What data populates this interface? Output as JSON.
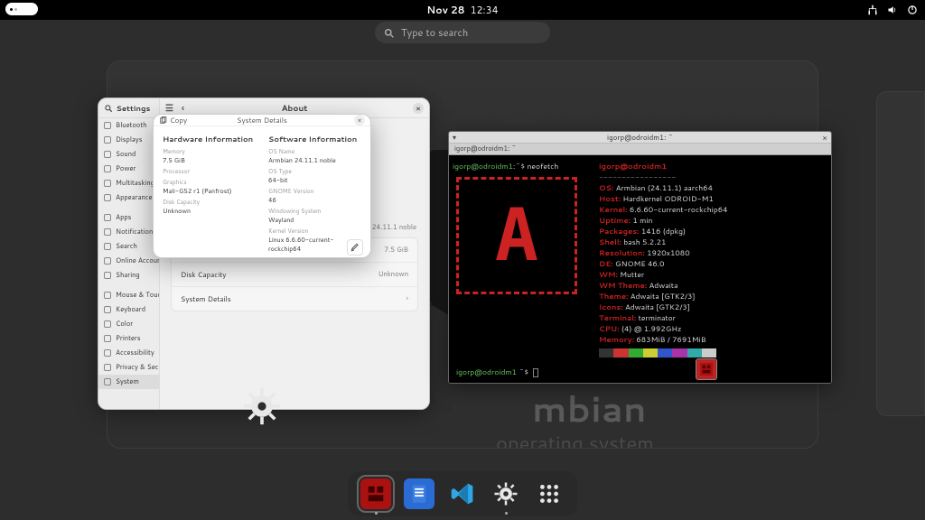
{
  "topbar": {
    "date": "Nov 28",
    "time": "12:34"
  },
  "search": {
    "placeholder": "Type to search"
  },
  "settings": {
    "sidebar_title": "Settings",
    "main_title": "About",
    "items": [
      "Bluetooth",
      "Displays",
      "Sound",
      "Power",
      "Multitasking",
      "Appearance",
      "Apps",
      "Notifications",
      "Search",
      "Online Accounts",
      "Sharing",
      "Mouse & Touchpad",
      "Keyboard",
      "Color",
      "Printers",
      "Accessibility",
      "Privacy & Security",
      "System"
    ],
    "about_rows": [
      {
        "k": "Memory",
        "v": "7.5 GiB"
      },
      {
        "k": "Disk Capacity",
        "v": "Unknown"
      },
      {
        "k": "System Details",
        "v": ""
      }
    ],
    "about_topline": "Armbian 24.11.1 noble"
  },
  "details": {
    "title": "System Details",
    "copy": "Copy",
    "hw": {
      "title": "Hardware Information",
      "memory_k": "Memory",
      "memory": "7.5 GiB",
      "proc_k": "Processor",
      "proc": "",
      "gpu_k": "Graphics",
      "gpu": "Mali-G52 r1 (Panfrost)",
      "disk_k": "Disk Capacity",
      "disk": "Unknown"
    },
    "sw": {
      "title": "Software Information",
      "os_k": "OS Name",
      "os": "Armbian 24.11.1 noble",
      "type_k": "OS Type",
      "type": "64-bit",
      "gnome_k": "GNOME Version",
      "gnome": "46",
      "ws_k": "Windowing System",
      "ws": "Wayland",
      "kernel_k": "Kernel Version",
      "kernel": "Linux 6.6.60-current-rockchip64"
    }
  },
  "term": {
    "title": "igorp@odroidm1: ~",
    "tab": "igorp@odroidm1: ~",
    "prompt_user": "igorp",
    "prompt_host": "odroidm1",
    "prompt_path": "~",
    "prompt_sym": "$",
    "cmd": "neofetch",
    "header": "igorp@odroidm1",
    "lines": [
      {
        "k": "OS",
        "v": "Armbian (24.11.1) aarch64"
      },
      {
        "k": "Host",
        "v": "Hardkernel ODROID-M1"
      },
      {
        "k": "Kernel",
        "v": "6.6.60-current-rockchip64"
      },
      {
        "k": "Uptime",
        "v": "1 min"
      },
      {
        "k": "Packages",
        "v": "1416 (dpkg)"
      },
      {
        "k": "Shell",
        "v": "bash 5.2.21"
      },
      {
        "k": "Resolution",
        "v": "1920x1080"
      },
      {
        "k": "DE",
        "v": "GNOME 46.0"
      },
      {
        "k": "WM",
        "v": "Mutter"
      },
      {
        "k": "WM Theme",
        "v": "Adwaita"
      },
      {
        "k": "Theme",
        "v": "Adwaita [GTK2/3]"
      },
      {
        "k": "Icons",
        "v": "Adwaita [GTK2/3]"
      },
      {
        "k": "Terminal",
        "v": "terminator"
      },
      {
        "k": "CPU",
        "v": "(4) @ 1.992GHz"
      },
      {
        "k": "Memory",
        "v": "683MiB / 7691MiB"
      }
    ],
    "swatches": [
      "#333",
      "#c33",
      "#3a3",
      "#cc3",
      "#35c",
      "#a3a",
      "#3aa",
      "#ccc"
    ]
  },
  "dock": {
    "items": [
      "terminator",
      "files",
      "vscode",
      "settings",
      "apps"
    ]
  },
  "wallpaper": {
    "title": "mbian",
    "sub": "operating system"
  }
}
